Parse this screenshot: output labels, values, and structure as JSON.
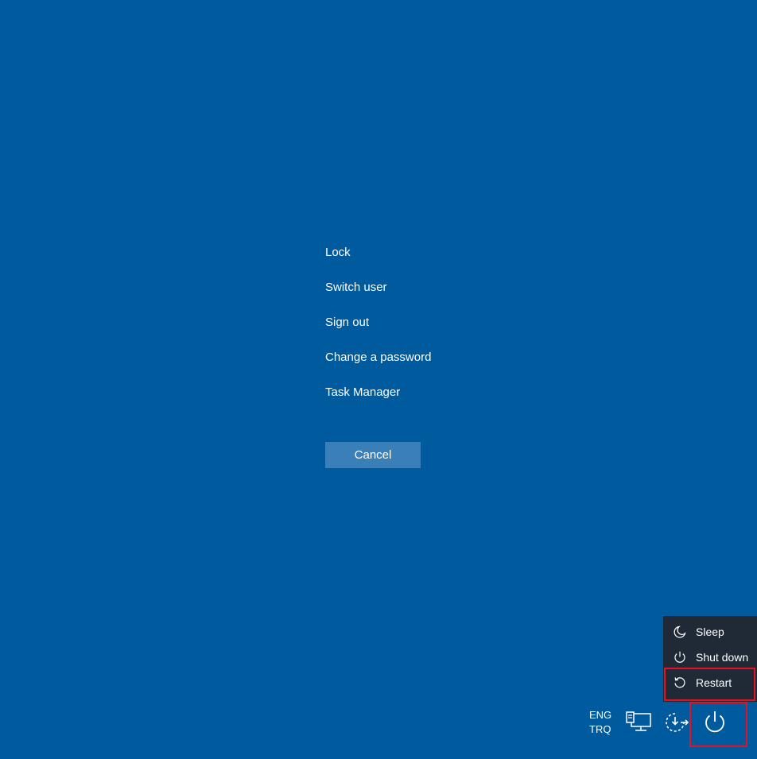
{
  "security_options": {
    "items": [
      {
        "label": "Lock"
      },
      {
        "label": "Switch user"
      },
      {
        "label": "Sign out"
      },
      {
        "label": "Change a password"
      },
      {
        "label": "Task Manager"
      }
    ],
    "cancel_label": "Cancel"
  },
  "power_menu": {
    "items": [
      {
        "label": "Sleep",
        "icon": "moon-icon"
      },
      {
        "label": "Shut down",
        "icon": "power-icon"
      },
      {
        "label": "Restart",
        "icon": "restart-icon"
      }
    ],
    "highlighted_item": "Restart"
  },
  "tray": {
    "language_line1": "ENG",
    "language_line2": "TRQ",
    "icons": [
      "network-icon",
      "ease-of-access-icon",
      "power-icon"
    ]
  },
  "colors": {
    "background": "#005a9e",
    "cancel_button": "#3a7fb8",
    "power_menu_background": "#1f2a36",
    "highlight": "#e81123"
  }
}
